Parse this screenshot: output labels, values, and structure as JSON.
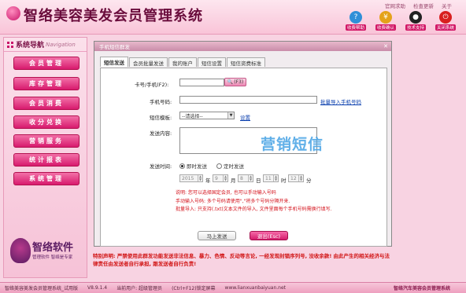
{
  "app": {
    "title": "智络美容美发会员管理系统"
  },
  "top_links": [
    "官网求助",
    "检查更新",
    "关于"
  ],
  "tools": [
    {
      "label": "收费帮助",
      "icon": "help-icon",
      "color": "#2f8fd8"
    },
    {
      "label": "收费确认",
      "icon": "money-icon",
      "color": "#e4a21a"
    },
    {
      "label": "技术支持",
      "icon": "qq-penguin-icon",
      "color": "#222222"
    },
    {
      "label": "关闭系统",
      "icon": "power-icon",
      "color": "#d81f1f"
    }
  ],
  "sidebar": {
    "title": "系统导航",
    "title_en": "Navigation",
    "items": [
      {
        "label": "会员管理"
      },
      {
        "label": "库存管理"
      },
      {
        "label": "会员消费"
      },
      {
        "label": "收分兑换"
      },
      {
        "label": "营销服务"
      },
      {
        "label": "统计报表"
      },
      {
        "label": "系统管理"
      }
    ],
    "logo_name": "智络软件",
    "logo_slogan": "管理软件 智络是专家"
  },
  "dialog": {
    "title": "手机短信群发",
    "tabs": [
      {
        "label": "短信发送",
        "active": true
      },
      {
        "label": "会员批量发送",
        "active": false
      },
      {
        "label": "我的账户",
        "active": false
      },
      {
        "label": "短信设置",
        "active": false
      },
      {
        "label": "短信资费标准",
        "active": false
      }
    ],
    "form": {
      "card_label": "卡号/手机(F2):",
      "card_value": "",
      "read_btn": "(F3)",
      "phone_label": "手机号码:",
      "phone_value": "",
      "import_link": "批量导入手机号码",
      "template_label": "短信模板:",
      "template_value": "--请选择--",
      "settings_link": "设置",
      "content_label": "发送内容:",
      "content_value": "",
      "watermark": "营销短信",
      "time_label": "发送时间:",
      "radio_now": "即时发送",
      "radio_timed": "定时发送",
      "year": "2015",
      "year_unit": "年",
      "month": "9",
      "month_unit": "月",
      "day": "8",
      "day_unit": "日",
      "hour": "11",
      "hour_unit": "时",
      "minute": "12",
      "minute_unit": "分"
    },
    "notes": [
      "说明: 您可以选择国定会员, 也可以手动输入号码",
      "手动输入号码: 多个号码请使用\",\"将多个号码分隔开来.",
      "批量导入: 只支持(.txt)文本文件的导入, 文件里面每个手机号码需换行填写."
    ],
    "send_btn": "马上发送",
    "exit_btn": "退出(Esc)"
  },
  "warning": "特别声明: 严禁使用此群发功能发送非法信息、暴力、色情、反动等言论, 一经发现封锁序列号, 没收余款! 由此产生的相关经济与法律责任由发送者自行承担, 跟发送者自行负责!",
  "status": {
    "product": "智络美容美发会员管理系统_试用版",
    "version": "V8.9.1.4",
    "user": "当前用户: 超级管理员",
    "hint": "(Ctrl+F12)锁定屏幕",
    "site": "www.lianxuanbaiyuan.net",
    "right": "智络汽车美容会员管理系统"
  }
}
